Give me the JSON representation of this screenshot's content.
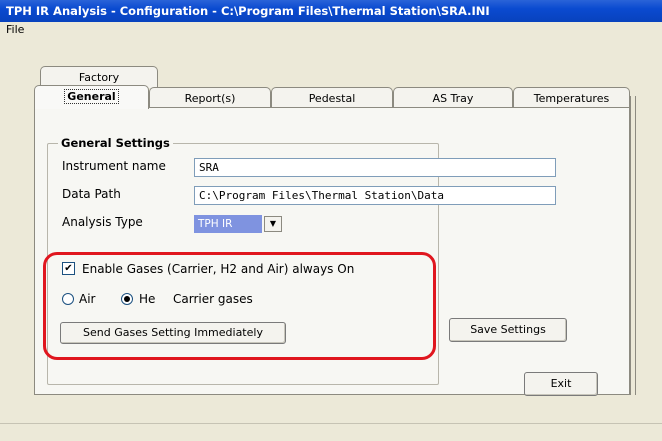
{
  "window": {
    "title": "TPH IR Analysis - Configuration - C:\\Program Files\\Thermal Station\\SRA.INI"
  },
  "menu": {
    "file": "File"
  },
  "tabs": {
    "back_row": [
      "Factory"
    ],
    "front_row": [
      "General",
      "Report(s)",
      "Pedestal",
      "AS Tray",
      "Temperatures"
    ],
    "active": "General"
  },
  "general": {
    "group_title": "General Settings",
    "instrument_name": {
      "label": "Instrument name",
      "value": "SRA"
    },
    "data_path": {
      "label": "Data Path",
      "value": "C:\\Program Files\\Thermal Station\\Data"
    },
    "analysis_type": {
      "label": "Analysis Type",
      "value": "TPH IR"
    },
    "enable_gases": {
      "label": "Enable Gases (Carrier, H2 and Air) always On",
      "checked": true
    },
    "carrier": {
      "air_label": "Air",
      "he_label": "He",
      "caption": "Carrier gases",
      "selected": "He"
    },
    "send_button": "Send Gases Setting Immediately",
    "save_button": "Save Settings"
  },
  "footer": {
    "exit_button": "Exit"
  },
  "colors": {
    "titlebar": "#0a4ad0",
    "highlight": "#e0161e",
    "combo_selected": "#7f93e0"
  }
}
